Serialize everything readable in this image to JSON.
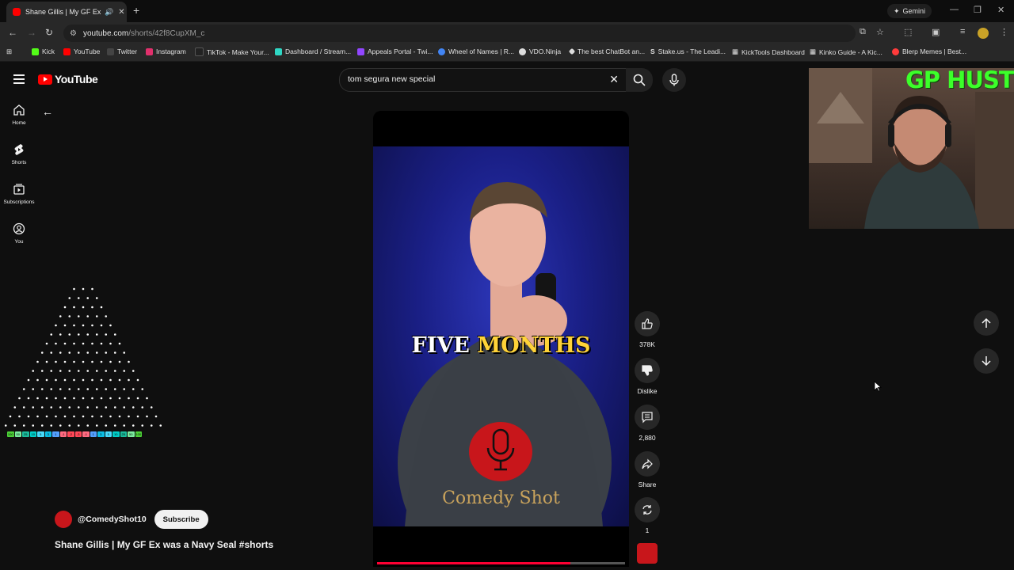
{
  "browser": {
    "tab_title": "Shane Gillis | My GF Ex was a Navy Seal #shorts",
    "gemini_label": "Gemini",
    "url_host": "youtube.com",
    "url_path": "/shorts/42f8CupXM_c"
  },
  "bookmarks": [
    {
      "label": "Kick",
      "color": "#53fc18"
    },
    {
      "label": "YouTube",
      "color": "#ff0000"
    },
    {
      "label": "Twitter",
      "color": "#000000"
    },
    {
      "label": "Instagram",
      "color": "#e1306c"
    },
    {
      "label": "TikTok - Make Your...",
      "color": "#111111"
    },
    {
      "label": "Dashboard / Stream...",
      "color": "#2fd7c4"
    },
    {
      "label": "Appeals Portal - Twi...",
      "color": "#9146ff"
    },
    {
      "label": "Wheel of Names | R...",
      "color": "#4285f4"
    },
    {
      "label": "VDO.Ninja",
      "color": "#ffffff"
    },
    {
      "label": "The best ChatBot an...",
      "color": "#ffffff"
    },
    {
      "label": "Stake.us - The Leadi...",
      "color": "#ffffff"
    },
    {
      "label": "KickTools Dashboard",
      "color": "#ffffff"
    },
    {
      "label": "Kinko Guide - A Kic...",
      "color": "#ffffff"
    },
    {
      "label": "Blerp Memes | Best...",
      "color": "#ff3b3b"
    }
  ],
  "youtube": {
    "logo_text": "YouTube",
    "search_query": "tom segura new special",
    "sidebar": [
      {
        "label": "Home",
        "icon": "home-icon"
      },
      {
        "label": "Shorts",
        "icon": "shorts-icon"
      },
      {
        "label": "Subscriptions",
        "icon": "subscriptions-icon"
      },
      {
        "label": "You",
        "icon": "user-icon"
      }
    ]
  },
  "video": {
    "caption_white": "FIVE",
    "caption_yellow": "MONTHS",
    "brand": "Comedy Shot",
    "progress": 0.78
  },
  "actions": {
    "likes": "378K",
    "dislike": "Dislike",
    "comments": "2,880",
    "share": "Share",
    "remix": "1"
  },
  "channel": {
    "handle": "@ComedyShot10",
    "subscribe": "Subscribe",
    "title": "Shane Gillis | My GF Ex was a Navy Seal #shorts"
  },
  "overlay": {
    "webcam_text": "GP HUSTLA",
    "plinko_slots": [
      "100",
      "50",
      "25",
      "10",
      "5",
      "3",
      "1",
      "-1",
      "-2",
      "-3",
      "-1",
      "1",
      "3",
      "5",
      "10",
      "25",
      "50",
      "100"
    ]
  }
}
